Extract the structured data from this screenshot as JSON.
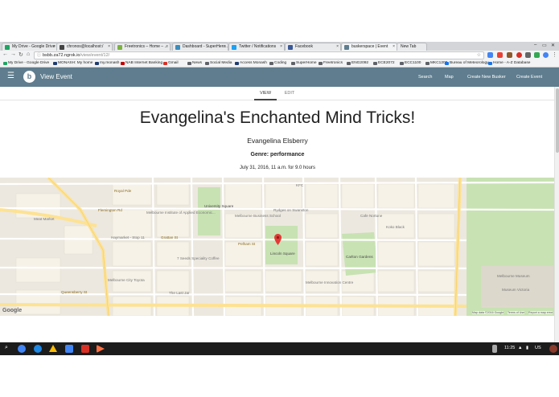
{
  "browser": {
    "tabs": [
      {
        "label": "My Drive - Google Drive",
        "icon": "drive-icon",
        "color": "#1fa463"
      },
      {
        "label": "chronos@localhost:/",
        "icon": "terminal-icon",
        "color": "#444444"
      },
      {
        "label": "Freetronics – Home – ...",
        "icon": "freetronics-icon",
        "color": "#7bb342"
      },
      {
        "label": "Dashboard - SuperHero...",
        "icon": "superhero-icon",
        "color": "#3c8dbc"
      },
      {
        "label": "Twitter / Notifications",
        "icon": "twitter-icon",
        "color": "#1da1f2"
      },
      {
        "label": "Facebook",
        "icon": "facebook-icon",
        "color": "#3b5998"
      },
      {
        "label": "buskerspace | Event",
        "icon": "buskerspace-icon",
        "color": "#5f7d8e"
      }
    ],
    "new_tab_label": "New Tab",
    "url_host": "bsbb.za72.ngrok.io",
    "url_path": "/view/event/12/",
    "bookmarks": [
      {
        "label": "My Drive - Google Drive",
        "color": "#1fa463"
      },
      {
        "label": "MONASH: My home",
        "color": "#1f3c6e"
      },
      {
        "label": "my.monash",
        "color": "#1f3c6e"
      },
      {
        "label": "NAB Internet Banking",
        "color": "#c00000"
      },
      {
        "label": "Gmail",
        "color": "#d93025"
      },
      {
        "label": "News",
        "color": "#5f6368"
      },
      {
        "label": "Social Media",
        "color": "#5f6368"
      },
      {
        "label": "Access Monash",
        "color": "#1f3c6e"
      },
      {
        "label": "Coding",
        "color": "#5f6368"
      },
      {
        "label": "SuperHome",
        "color": "#5f6368"
      },
      {
        "label": "Freetronics",
        "color": "#5f6368"
      },
      {
        "label": "ENG2092",
        "color": "#5f6368"
      },
      {
        "label": "ECE2072",
        "color": "#5f6368"
      },
      {
        "label": "ECC1100",
        "color": "#5f6368"
      },
      {
        "label": "MKC1200",
        "color": "#5f6368"
      },
      {
        "label": "Bureau of Meteorology",
        "color": "#1a73e8"
      },
      {
        "label": "Home - A-Z Database",
        "color": "#1a73e8"
      }
    ]
  },
  "app": {
    "brand_letter": "b",
    "title": "View Event",
    "nav": [
      "Search",
      "Map",
      "Create New Busker",
      "Create Event"
    ],
    "bar_color": "#5f7d8e"
  },
  "view_tabs": {
    "view": "VIEW",
    "edit": "EDIT"
  },
  "event": {
    "title": "Evangelina's Enchanted Mind Tricks!",
    "performer": "Evangelina Elsberry",
    "genre": "Genre: performance",
    "date": "July 31, 2016, 11 a.m. for 9.0 hours"
  },
  "map": {
    "labels": [
      {
        "text": "Melbourne Institute of Applied Economic...",
        "kind": "poi"
      },
      {
        "text": "University Square",
        "kind": "place"
      },
      {
        "text": "Rydges on Swanston",
        "kind": "poi"
      },
      {
        "text": "KFC",
        "kind": "poi"
      },
      {
        "text": "Cafe Nortune",
        "kind": "poi"
      },
      {
        "text": "Koko Black",
        "kind": "poi"
      },
      {
        "text": "Melbourne Business School",
        "kind": "poi"
      },
      {
        "text": "Meat Market",
        "kind": "poi"
      },
      {
        "text": "Flemington Rd",
        "kind": "road"
      },
      {
        "text": "Royal Pde",
        "kind": "road"
      },
      {
        "text": "Pelham St",
        "kind": "road"
      },
      {
        "text": "Grattan St",
        "kind": "road"
      },
      {
        "text": "Queensberry St",
        "kind": "road"
      },
      {
        "text": "Haymarket - Stop 11",
        "kind": "poi"
      },
      {
        "text": "7 Seeds Speciality Coffee",
        "kind": "poi"
      },
      {
        "text": "Melbourne City Toyota",
        "kind": "poi"
      },
      {
        "text": "The Last Jar",
        "kind": "poi"
      },
      {
        "text": "Melbourne Museum",
        "kind": "poi"
      },
      {
        "text": "Museum Victoria",
        "kind": "poi"
      },
      {
        "text": "Lincoln Square",
        "kind": "place"
      },
      {
        "text": "Carlton Gardens",
        "kind": "place"
      },
      {
        "text": "Melbourne Innovation Centre",
        "kind": "poi"
      }
    ],
    "google": "Google",
    "footer": [
      "Map data ©2016 Google",
      "Terms of Use",
      "Report a map error"
    ]
  },
  "taskbar": {
    "time": "11:25",
    "locale": "US"
  }
}
